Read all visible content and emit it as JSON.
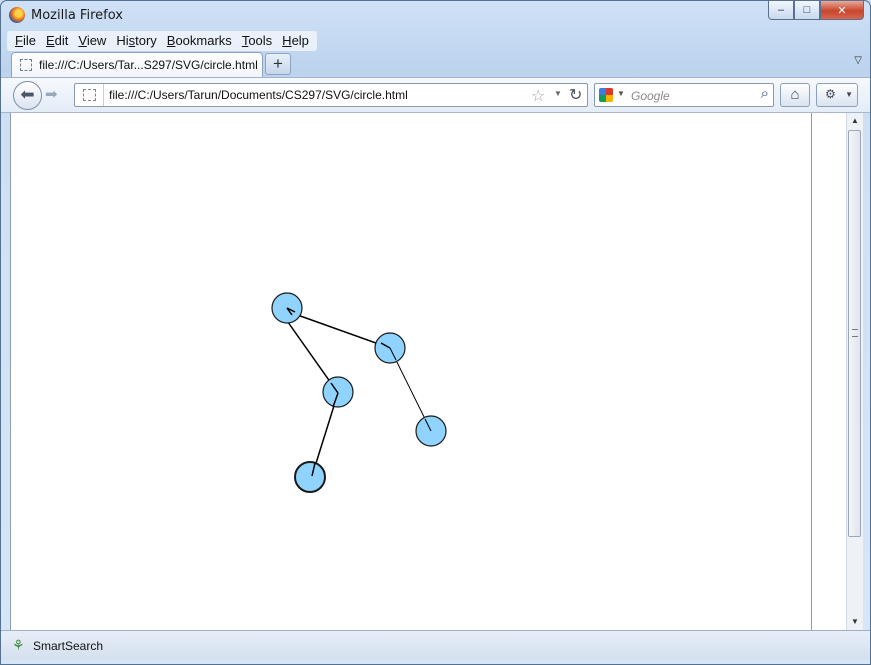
{
  "window": {
    "title": "Mozilla Firefox",
    "controls": {
      "minimize": "–",
      "maximize": "□",
      "close": "✕"
    }
  },
  "menubar": {
    "items": [
      {
        "label": "File",
        "accel": "F"
      },
      {
        "label": "Edit",
        "accel": "E"
      },
      {
        "label": "View",
        "accel": "V"
      },
      {
        "label": "History",
        "accel": "s"
      },
      {
        "label": "Bookmarks",
        "accel": "B"
      },
      {
        "label": "Tools",
        "accel": "T"
      },
      {
        "label": "Help",
        "accel": "H"
      }
    ]
  },
  "tabs": [
    {
      "label": "file:///C:/Users/Tar...S297/SVG/circle.html",
      "active": true
    }
  ],
  "newtab_label": "+",
  "navbar": {
    "url": "file:///C:/Users/Tarun/Documents/CS297/SVG/circle.html",
    "search_placeholder": "Google",
    "icons": [
      "back-icon",
      "forward-icon",
      "site-identity-icon",
      "bookmark-star-icon",
      "reload-icon",
      "search-engine-icon",
      "magnifier-icon",
      "home-icon",
      "addon-icon"
    ]
  },
  "statusbar": {
    "text": "SmartSearch"
  },
  "colors": {
    "node_fill": "#8fd3fe",
    "node_stroke": "#1a1a1a",
    "edge_stroke": "#000000",
    "chrome_blue": "#c9dcf1"
  }
}
